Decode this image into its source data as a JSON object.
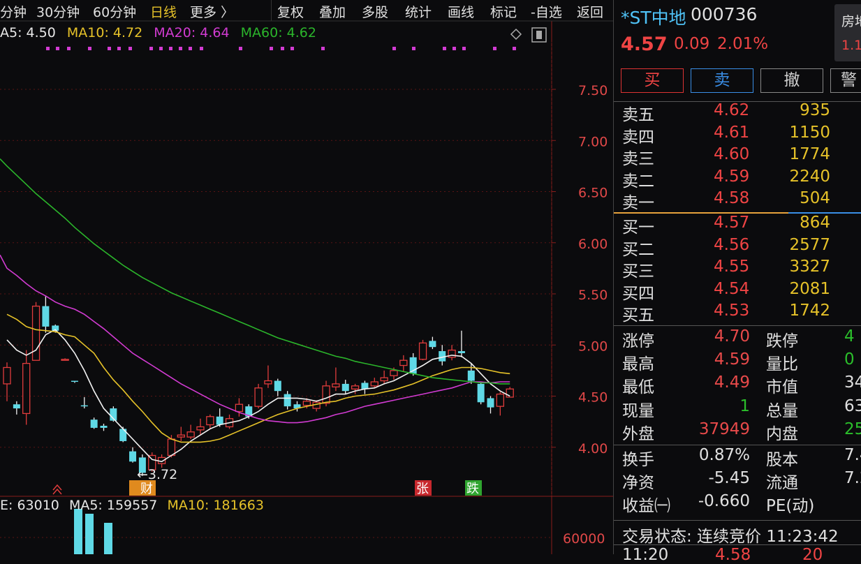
{
  "toolbar": {
    "tabs": [
      "分钟",
      "30分钟",
      "60分钟",
      "日线",
      "更多 〉"
    ],
    "actions": [
      "复权",
      "叠加",
      "多股",
      "统计",
      "画线",
      "标记",
      "-自选",
      "返回"
    ]
  },
  "ma_legend": [
    {
      "label": "A5: 4.50",
      "color": "#e8e8e8"
    },
    {
      "label": "MA10: 4.72",
      "color": "#e6c229"
    },
    {
      "label": "MA20: 4.64",
      "color": "#d23bd2"
    },
    {
      "label": "MA60: 4.62",
      "color": "#2bb52b"
    }
  ],
  "vol_legend": [
    {
      "label": "E: 63010",
      "color": "#e8e8e8"
    },
    {
      "label": "MA5: 159557",
      "color": "#e8e8e8"
    },
    {
      "label": "MA10: 181663",
      "color": "#e6c229"
    }
  ],
  "chart_data": {
    "type": "candlestick",
    "y_ticks": [
      "7.50",
      "7.00",
      "6.50",
      "6.00",
      "5.50",
      "5.00",
      "4.50",
      "4.00"
    ],
    "ylim": [
      3.55,
      7.9
    ],
    "low_marker": "←3.72",
    "volume_tick": "60000",
    "event_tags": [
      {
        "text": "财",
        "color": "#e08a1e"
      },
      {
        "text": "张",
        "color": "#c8282d"
      },
      {
        "text": "跌",
        "color": "#2fa52f"
      }
    ],
    "candles": [
      [
        4.62,
        4.78,
        4.83,
        4.45
      ],
      [
        4.42,
        4.38,
        4.45,
        4.32
      ],
      [
        4.33,
        4.82,
        4.95,
        4.22
      ],
      [
        4.85,
        5.38,
        5.42,
        4.88
      ],
      [
        5.38,
        5.18,
        5.48,
        5.12
      ],
      [
        5.19,
        5.14,
        5.2,
        5.12
      ],
      [
        4.86,
        4.86,
        4.87,
        4.85
      ],
      [
        4.65,
        4.64,
        4.65,
        4.63
      ],
      [
        4.41,
        4.4,
        4.49,
        4.38
      ],
      [
        4.27,
        4.19,
        4.29,
        4.18
      ],
      [
        4.21,
        4.19,
        4.23,
        4.16
      ],
      [
        4.38,
        4.26,
        4.4,
        4.25
      ],
      [
        4.18,
        4.06,
        4.2,
        4.05
      ],
      [
        3.96,
        3.86,
        4.0,
        3.85
      ],
      [
        3.9,
        3.75,
        3.93,
        3.72
      ],
      [
        3.78,
        3.92,
        3.95,
        3.76
      ],
      [
        3.84,
        3.9,
        3.93,
        3.8
      ],
      [
        3.92,
        4.08,
        4.12,
        3.9
      ],
      [
        4.1,
        4.12,
        4.2,
        4.06
      ],
      [
        4.1,
        4.15,
        4.22,
        4.08
      ],
      [
        4.17,
        4.2,
        4.28,
        4.12
      ],
      [
        4.22,
        4.3,
        4.32,
        4.18
      ],
      [
        4.3,
        4.22,
        4.38,
        4.2
      ],
      [
        4.2,
        4.28,
        4.32,
        4.18
      ],
      [
        4.35,
        4.42,
        4.48,
        4.3
      ],
      [
        4.4,
        4.3,
        4.42,
        4.28
      ],
      [
        4.4,
        4.58,
        4.62,
        4.38
      ],
      [
        4.62,
        4.65,
        4.8,
        4.58
      ],
      [
        4.65,
        4.55,
        4.67,
        4.5
      ],
      [
        4.52,
        4.4,
        4.55,
        4.37
      ],
      [
        4.42,
        4.38,
        4.45,
        4.35
      ],
      [
        4.41,
        4.45,
        4.48,
        4.38
      ],
      [
        4.38,
        4.44,
        4.46,
        4.35
      ],
      [
        4.43,
        4.6,
        4.65,
        4.4
      ],
      [
        4.59,
        4.62,
        4.78,
        4.55
      ],
      [
        4.62,
        4.55,
        4.66,
        4.52
      ],
      [
        4.57,
        4.6,
        4.62,
        4.52
      ],
      [
        4.63,
        4.57,
        4.65,
        4.52
      ],
      [
        4.6,
        4.64,
        4.68,
        4.58
      ],
      [
        4.65,
        4.68,
        4.75,
        4.62
      ],
      [
        4.7,
        4.75,
        4.78,
        4.66
      ],
      [
        4.8,
        4.85,
        4.9,
        4.74
      ],
      [
        4.88,
        4.72,
        4.92,
        4.7
      ],
      [
        4.86,
        5.02,
        5.05,
        4.85
      ],
      [
        5.04,
        4.98,
        5.08,
        4.96
      ],
      [
        4.94,
        4.84,
        5.0,
        4.8
      ],
      [
        4.88,
        4.95,
        5.0,
        4.85
      ],
      [
        4.94,
        4.92,
        5.14,
        4.88
      ],
      [
        4.75,
        4.65,
        4.82,
        4.62
      ],
      [
        4.62,
        4.44,
        4.64,
        4.42
      ],
      [
        4.48,
        4.39,
        4.5,
        4.33
      ],
      [
        4.4,
        4.52,
        4.54,
        4.31
      ],
      [
        4.49,
        4.57,
        4.59,
        4.49
      ]
    ],
    "ma": {
      "MA5": [
        5.05,
        4.95,
        4.9,
        4.95,
        5.1,
        5.15,
        5.05,
        4.92,
        4.75,
        4.55,
        4.38,
        4.28,
        4.18,
        4.08,
        3.98,
        3.88,
        3.86,
        3.92,
        3.98,
        4.06,
        4.12,
        4.18,
        4.22,
        4.24,
        4.26,
        4.3,
        4.35,
        4.42,
        4.48,
        4.48,
        4.48,
        4.47,
        4.45,
        4.48,
        4.52,
        4.52,
        4.55,
        4.57,
        4.58,
        4.62,
        4.65,
        4.7,
        4.75,
        4.8,
        4.86,
        4.88,
        4.9,
        4.89,
        4.82,
        4.72,
        4.62,
        4.55,
        4.5
      ],
      "MA10": [
        5.3,
        5.25,
        5.18,
        5.15,
        5.14,
        5.13,
        5.1,
        5.08,
        5.0,
        4.92,
        4.78,
        4.66,
        4.56,
        4.45,
        4.35,
        4.24,
        4.14,
        4.08,
        4.05,
        4.05,
        4.05,
        4.06,
        4.08,
        4.12,
        4.16,
        4.2,
        4.24,
        4.28,
        4.32,
        4.35,
        4.38,
        4.4,
        4.42,
        4.44,
        4.45,
        4.48,
        4.5,
        4.51,
        4.52,
        4.54,
        4.56,
        4.59,
        4.62,
        4.66,
        4.7,
        4.73,
        4.76,
        4.78,
        4.78,
        4.77,
        4.75,
        4.73,
        4.72
      ],
      "MA20": [
        5.75,
        5.68,
        5.6,
        5.53,
        5.48,
        5.42,
        5.38,
        5.35,
        5.3,
        5.23,
        5.16,
        5.08,
        5.0,
        4.92,
        4.86,
        4.8,
        4.74,
        4.68,
        4.62,
        4.57,
        4.52,
        4.47,
        4.42,
        4.38,
        4.34,
        4.31,
        4.28,
        4.26,
        4.25,
        4.24,
        4.24,
        4.25,
        4.27,
        4.29,
        4.32,
        4.34,
        4.37,
        4.4,
        4.42,
        4.44,
        4.46,
        4.48,
        4.5,
        4.52,
        4.54,
        4.56,
        4.58,
        4.61,
        4.64,
        4.64,
        4.63,
        4.64,
        4.64
      ],
      "MA60": [
        6.75,
        6.66,
        6.57,
        6.48,
        6.4,
        6.32,
        6.24,
        6.15,
        6.07,
        5.99,
        5.92,
        5.85,
        5.78,
        5.72,
        5.66,
        5.61,
        5.56,
        5.51,
        5.47,
        5.43,
        5.39,
        5.35,
        5.31,
        5.27,
        5.23,
        5.19,
        5.15,
        5.11,
        5.07,
        5.04,
        5.01,
        4.98,
        4.95,
        4.92,
        4.89,
        4.87,
        4.84,
        4.82,
        4.8,
        4.78,
        4.76,
        4.74,
        4.72,
        4.7,
        4.68,
        4.67,
        4.66,
        4.65,
        4.64,
        4.63,
        4.63,
        4.62,
        4.62
      ]
    },
    "volume": [
      {
        "x": 112,
        "h": 65,
        "up": false
      },
      {
        "x": 128,
        "h": 58,
        "up": false
      },
      {
        "x": 155,
        "h": 45,
        "up": false
      }
    ]
  },
  "stock": {
    "name": "*ST中地",
    "code": "000736",
    "price": "4.57",
    "change": "0.09",
    "change_pct": "2.01%",
    "side_label": "房地",
    "side_value": "1.1"
  },
  "buttons": [
    "买",
    "卖",
    "撤",
    "警"
  ],
  "sell_book": [
    {
      "label": "卖五",
      "price": "4.62",
      "vol": "935"
    },
    {
      "label": "卖四",
      "price": "4.61",
      "vol": "1150"
    },
    {
      "label": "卖三",
      "price": "4.60",
      "vol": "1774"
    },
    {
      "label": "卖二",
      "price": "4.59",
      "vol": "2240"
    },
    {
      "label": "卖一",
      "price": "4.58",
      "vol": "504"
    }
  ],
  "buy_book": [
    {
      "label": "买一",
      "price": "4.57",
      "vol": "864"
    },
    {
      "label": "买二",
      "price": "4.56",
      "vol": "2577"
    },
    {
      "label": "买三",
      "price": "4.55",
      "vol": "3327"
    },
    {
      "label": "买四",
      "price": "4.54",
      "vol": "2081"
    },
    {
      "label": "买五",
      "price": "4.53",
      "vol": "1742"
    }
  ],
  "stats1": [
    {
      "l1": "涨停",
      "v1": "4.70",
      "c1": "#e84a4a",
      "l2": "跌停",
      "v2": "4",
      "c2": "#2bbf2b"
    },
    {
      "l1": "最高",
      "v1": "4.59",
      "c1": "#e84a4a",
      "l2": "量比",
      "v2": "0",
      "c2": "#2bbf2b"
    },
    {
      "l1": "最低",
      "v1": "4.49",
      "c1": "#e84a4a",
      "l2": "市值",
      "v2": "34",
      "c2": "#e0e0e0"
    },
    {
      "l1": "现量",
      "v1": "1",
      "c1": "#2bbf2b",
      "l2": "总量",
      "v2": "63",
      "c2": "#e0e0e0"
    },
    {
      "l1": "外盘",
      "v1": "37949",
      "c1": "#e84a4a",
      "l2": "内盘",
      "v2": "25",
      "c2": "#2bbf2b"
    }
  ],
  "stats2": [
    {
      "l1": "换手",
      "v1": "0.87%",
      "l2": "股本",
      "v2": "7.4"
    },
    {
      "l1": "净资",
      "v1": "-5.45",
      "l2": "流通",
      "v2": "7.2"
    },
    {
      "l1": "收益㈠",
      "v1": "-0.660",
      "l2": "PE(动)",
      "v2": ""
    }
  ],
  "trade_status": "交易状态: 连续竞价 11:23:42",
  "tick_partial": {
    "time": "11:20",
    "price": "4.58",
    "vol": "20"
  }
}
